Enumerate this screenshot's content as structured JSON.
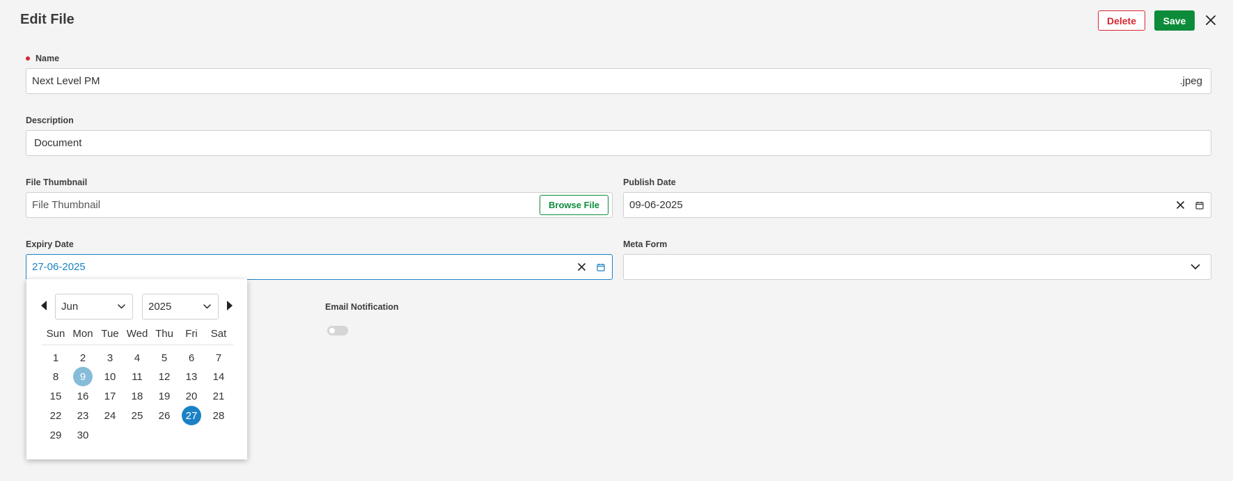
{
  "header": {
    "title": "Edit File",
    "delete_label": "Delete",
    "save_label": "Save"
  },
  "fields": {
    "name": {
      "label": "Name",
      "value": "Next Level PM",
      "extension": ".jpeg"
    },
    "description": {
      "label": "Description",
      "value": "Document"
    },
    "file_thumbnail": {
      "label": "File Thumbnail",
      "placeholder": "File Thumbnail",
      "browse_label": "Browse File"
    },
    "publish_date": {
      "label": "Publish Date",
      "value": "09-06-2025"
    },
    "expiry_date": {
      "label": "Expiry Date",
      "value": "27-06-2025"
    },
    "meta_form": {
      "label": "Meta Form",
      "value": ""
    },
    "email_notification": {
      "label": "Email Notification",
      "enabled": false
    }
  },
  "calendar": {
    "month": "Jun",
    "year": "2025",
    "weekdays": [
      "Sun",
      "Mon",
      "Tue",
      "Wed",
      "Thu",
      "Fri",
      "Sat"
    ],
    "days": [
      "1",
      "2",
      "3",
      "4",
      "5",
      "6",
      "7",
      "8",
      "9",
      "10",
      "11",
      "12",
      "13",
      "14",
      "15",
      "16",
      "17",
      "18",
      "19",
      "20",
      "21",
      "22",
      "23",
      "24",
      "25",
      "26",
      "27",
      "28",
      "29",
      "30"
    ],
    "first_weekday_index": 0,
    "today": "9",
    "selected": "27"
  },
  "colors": {
    "accent": "#1a82c4",
    "success": "#0c8c3a",
    "danger": "#d9262f"
  }
}
